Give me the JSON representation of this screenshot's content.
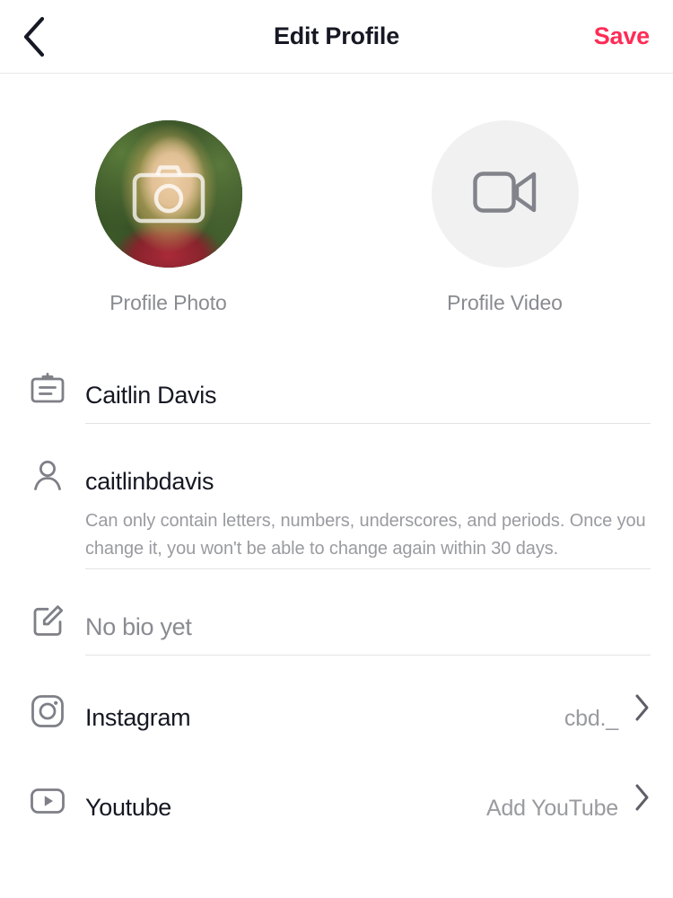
{
  "header": {
    "back_icon": "chevron-left-icon",
    "title": "Edit Profile",
    "save_label": "Save"
  },
  "media": {
    "photo": {
      "label": "Profile Photo",
      "overlay_icon": "camera-icon"
    },
    "video": {
      "label": "Profile Video",
      "icon": "video-camera-icon"
    }
  },
  "form": {
    "name": {
      "icon": "id-card-icon",
      "value": "Caitlin Davis"
    },
    "username": {
      "icon": "person-icon",
      "value": "caitlinbdavis",
      "hint": "Can only contain letters, numbers, underscores, and periods. Once you change it, you won't be able to change again within 30 days."
    },
    "bio": {
      "icon": "edit-pencil-icon",
      "placeholder": "No bio yet"
    },
    "instagram": {
      "icon": "instagram-icon",
      "label": "Instagram",
      "value": "cbd._",
      "chevron": "chevron-right-icon"
    },
    "youtube": {
      "icon": "youtube-icon",
      "label": "Youtube",
      "value": "Add YouTube",
      "chevron": "chevron-right-icon"
    }
  },
  "colors": {
    "accent": "#fe2c55",
    "text": "#161823",
    "muted": "#8a8b91",
    "divider": "#e3e3e5",
    "video_circle_bg": "#f1f1f2"
  }
}
